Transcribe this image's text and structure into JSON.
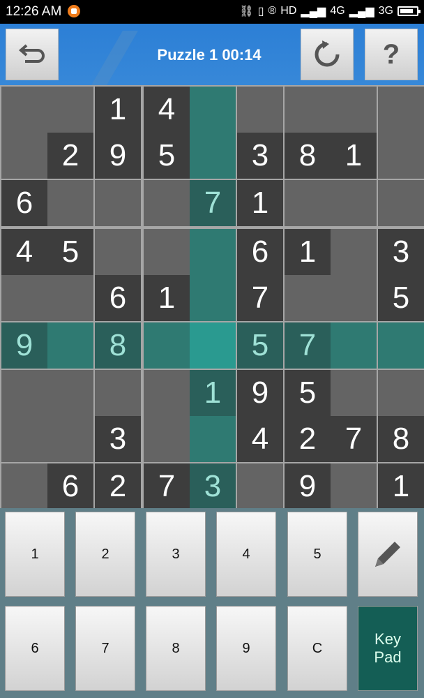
{
  "status_bar": {
    "time": "12:26 AM",
    "hd": "HD",
    "net1": "4G",
    "net2": "3G"
  },
  "header": {
    "title": "Puzzle 1 00:14",
    "back_icon": "undo-arrow-icon",
    "reload_icon": "reload-icon",
    "help_label": "?"
  },
  "board": {
    "cells": [
      [
        " ",
        " ",
        "1",
        "4",
        " ",
        " ",
        " ",
        " ",
        " "
      ],
      [
        " ",
        "2",
        "9",
        "5",
        " ",
        "3",
        "8",
        "1",
        " "
      ],
      [
        "6",
        " ",
        " ",
        " ",
        "7",
        "1",
        " ",
        " ",
        " "
      ],
      [
        "4",
        "5",
        " ",
        " ",
        " ",
        "6",
        "1",
        " ",
        "3"
      ],
      [
        " ",
        " ",
        "6",
        "1",
        " ",
        "7",
        " ",
        " ",
        "5"
      ],
      [
        "9",
        " ",
        "8",
        " ",
        " ",
        "5",
        "7",
        " ",
        " "
      ],
      [
        " ",
        " ",
        " ",
        " ",
        "1",
        "9",
        "5",
        " ",
        " "
      ],
      [
        " ",
        " ",
        "3",
        " ",
        " ",
        "4",
        "2",
        "7",
        "8"
      ],
      [
        " ",
        "6",
        "2",
        "7",
        "3",
        " ",
        "9",
        " ",
        "1"
      ]
    ],
    "selected_row": 5,
    "selected_col": 4,
    "highlight_color": "#2f7a72"
  },
  "keypad": {
    "row1": [
      "1",
      "2",
      "3",
      "4",
      "5"
    ],
    "row2": [
      "6",
      "7",
      "8",
      "9",
      "C"
    ],
    "pencil_icon": "pencil-icon",
    "keypad_label": "Key Pad"
  }
}
